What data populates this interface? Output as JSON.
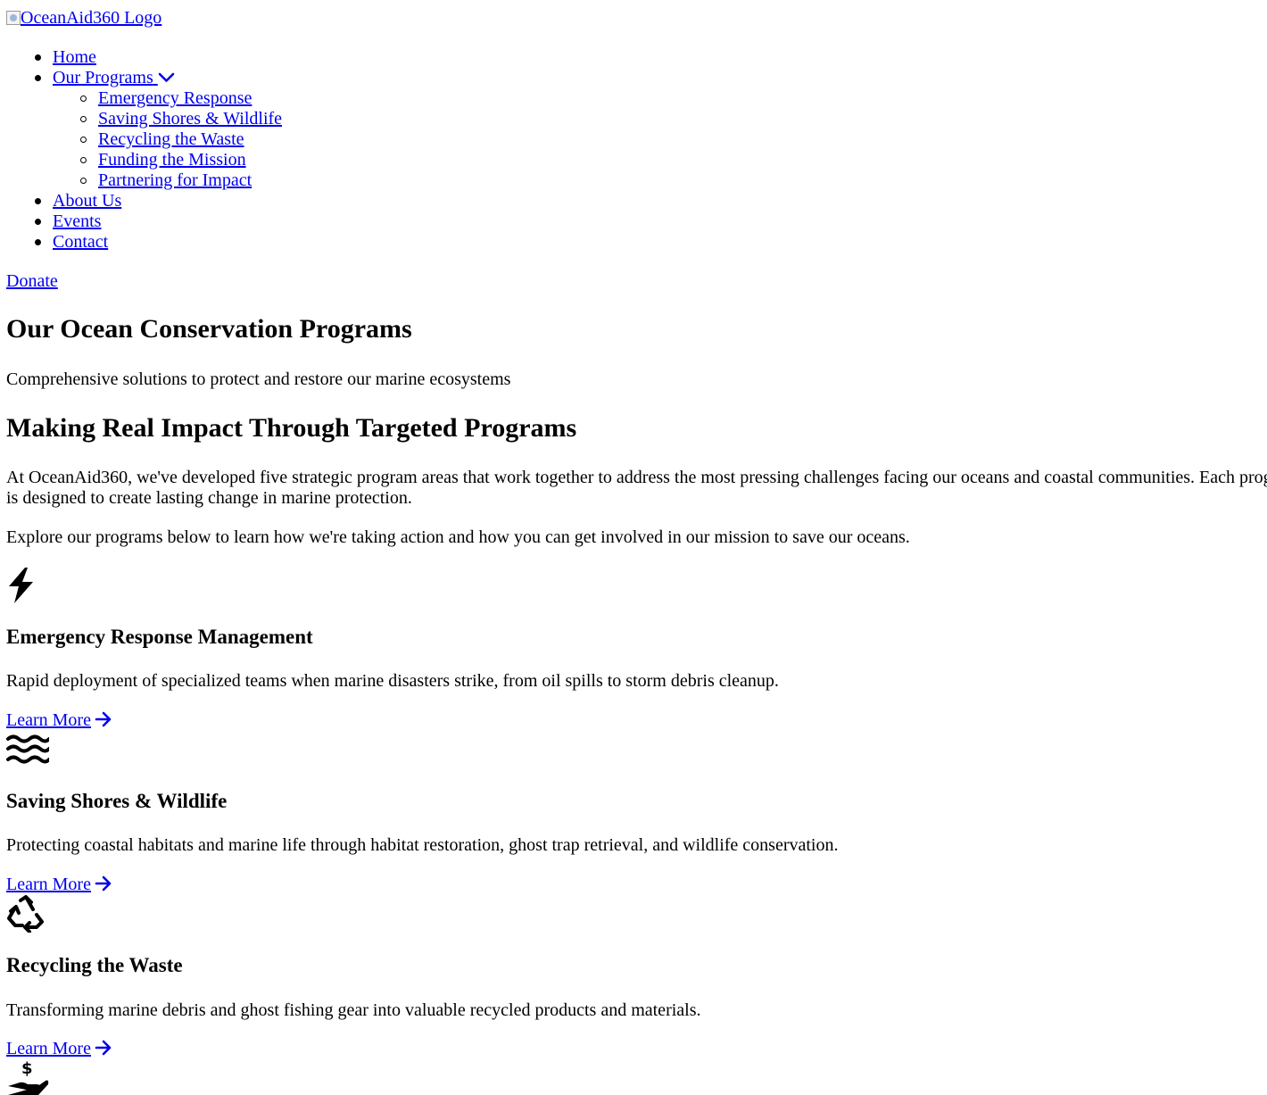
{
  "header": {
    "logo_alt": "OceanAid360 Logo",
    "nav": [
      {
        "label": "Home"
      },
      {
        "label": "Our Programs",
        "icon": "chevron-down-icon",
        "submenu": [
          {
            "label": "Emergency Response"
          },
          {
            "label": "Saving Shores & Wildlife"
          },
          {
            "label": "Recycling the Waste"
          },
          {
            "label": "Funding the Mission"
          },
          {
            "label": "Partnering for Impact"
          }
        ]
      },
      {
        "label": "About Us"
      },
      {
        "label": "Events"
      },
      {
        "label": "Contact"
      }
    ],
    "donate_label": "Donate"
  },
  "hero": {
    "title": "Our Ocean Conservation Programs",
    "subtitle": "Comprehensive solutions to protect and restore our marine ecosystems"
  },
  "intro": {
    "heading": "Making Real Impact Through Targeted Programs",
    "paragraph": "At OceanAid360, we've developed five strategic program areas that work together to address the most pressing challenges facing our oceans and coastal communities. Each program is designed to create lasting change in marine protection.",
    "explore": "Explore our programs below to learn how we're taking action and how you can get involved in our mission to save our oceans."
  },
  "programs": [
    {
      "icon": "lightning-bolt-icon",
      "title": "Emergency Response Management",
      "description": "Rapid deployment of specialized teams when marine disasters strike, from oil spills to storm debris cleanup.",
      "link": "Learn More"
    },
    {
      "icon": "water-waves-icon",
      "title": "Saving Shores & Wildlife",
      "description": "Protecting coastal habitats and marine life through habitat restoration, ghost trap retrieval, and wildlife conservation.",
      "link": "Learn More"
    },
    {
      "icon": "recycle-icon",
      "title": "Recycling the Waste",
      "description": "Transforming marine debris and ghost fishing gear into valuable recycled products and materials.",
      "link": "Learn More"
    },
    {
      "icon": "hand-holding-dollar-icon"
    }
  ],
  "colors": {
    "link": "#0000ee",
    "text": "#000000",
    "background": "#ffffff"
  }
}
